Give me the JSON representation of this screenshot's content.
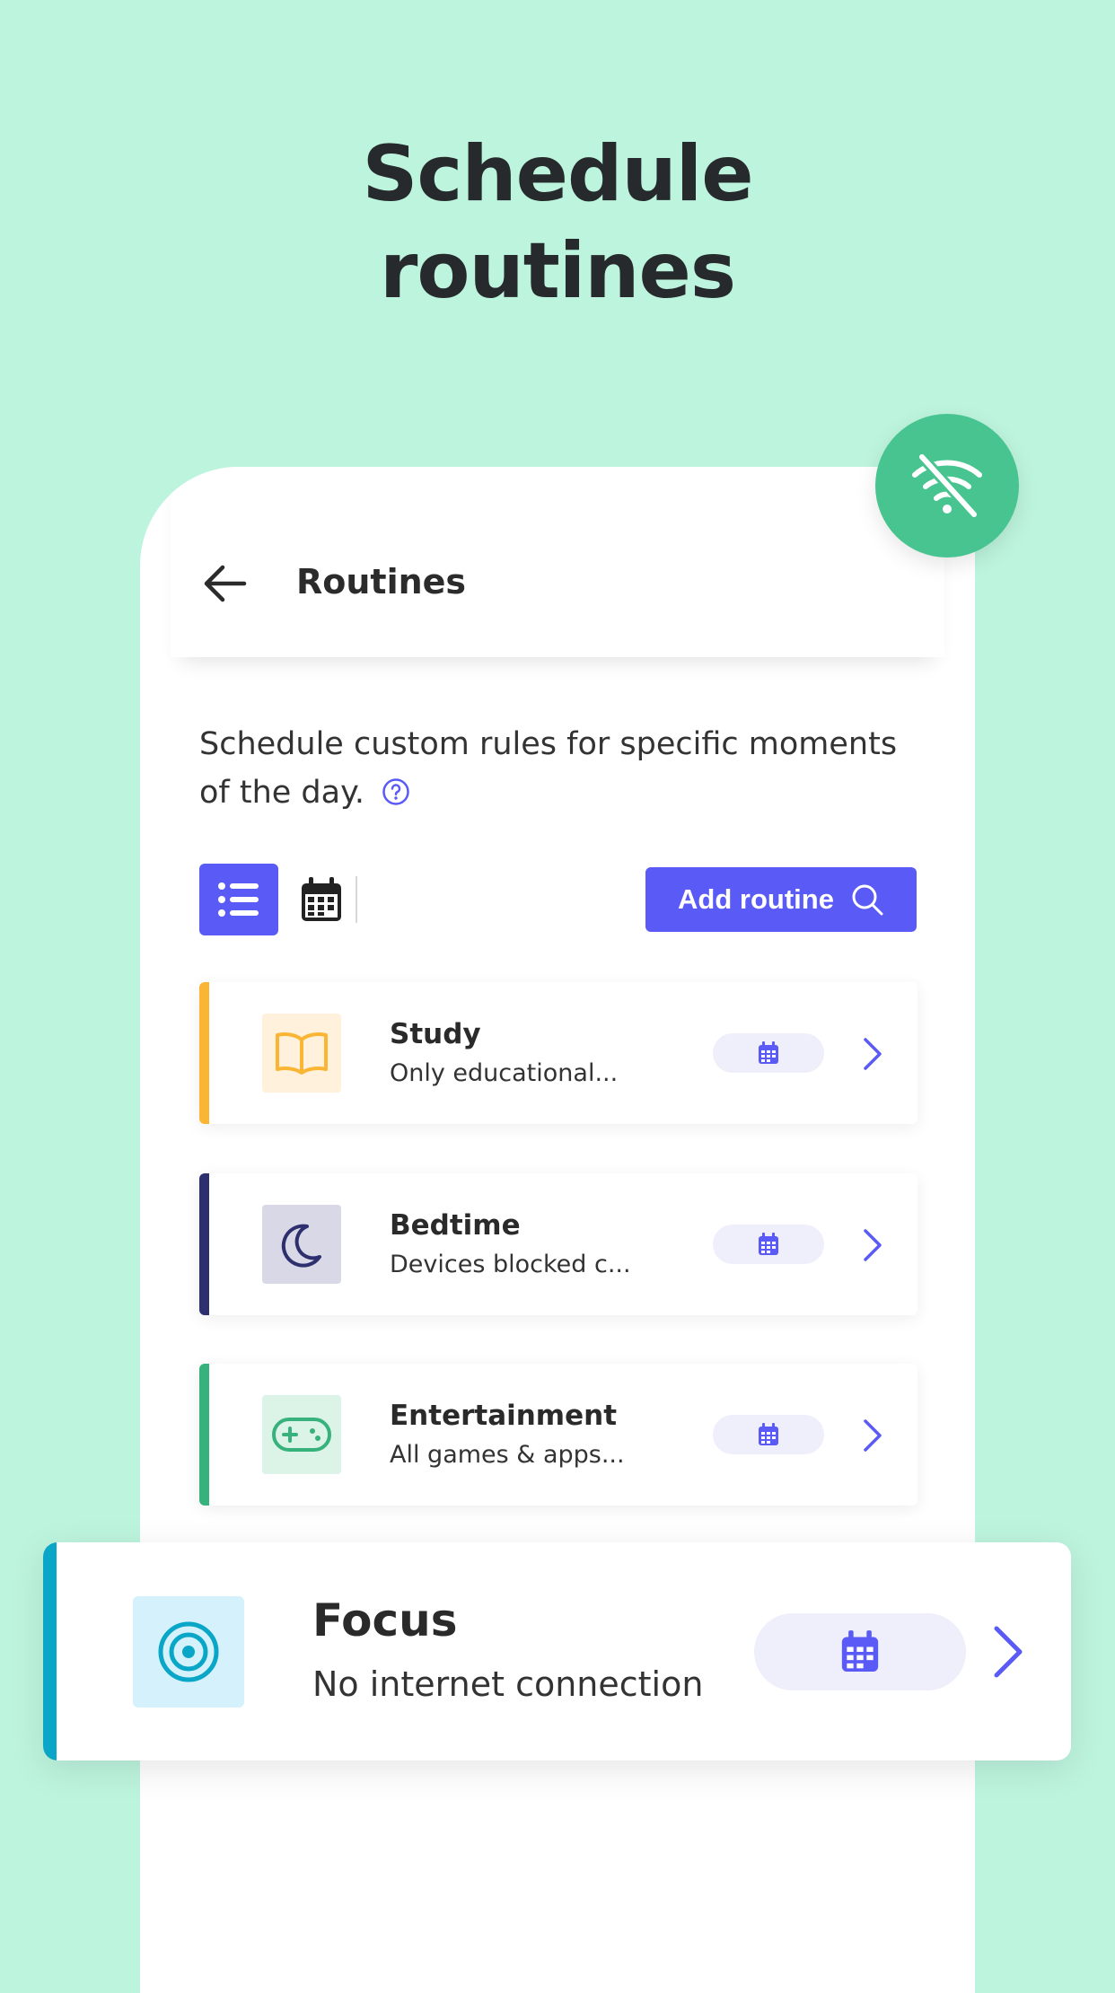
{
  "headline": {
    "line1": "Schedule",
    "line2": "routines"
  },
  "header": {
    "title": "Routines"
  },
  "intro": {
    "text": "Schedule custom rules for specific moments of the day."
  },
  "toolbar": {
    "add_label": "Add routine"
  },
  "routines": [
    {
      "title": "Study",
      "subtitle": "Only educational...",
      "accent": "#fbb535",
      "icon_bg": "#fff1dc",
      "icon": "book-icon"
    },
    {
      "title": "Bedtime",
      "subtitle": "Devices blocked c...",
      "accent": "#2d2f6e",
      "icon_bg": "#d8d8e6",
      "icon": "moon-icon"
    },
    {
      "title": "Entertainment",
      "subtitle": "All games & apps...",
      "accent": "#38b27d",
      "icon_bg": "#dcf3e8",
      "icon": "gamepad-icon"
    }
  ],
  "focus": {
    "title": "Focus",
    "subtitle": "No internet connection",
    "accent": "#0aa6c8",
    "icon": "target-icon"
  },
  "colors": {
    "background": "#bdf4dd",
    "primary": "#5a5af7",
    "badge": "#47c48f"
  },
  "badge": {
    "icon": "wifi-off-icon"
  }
}
